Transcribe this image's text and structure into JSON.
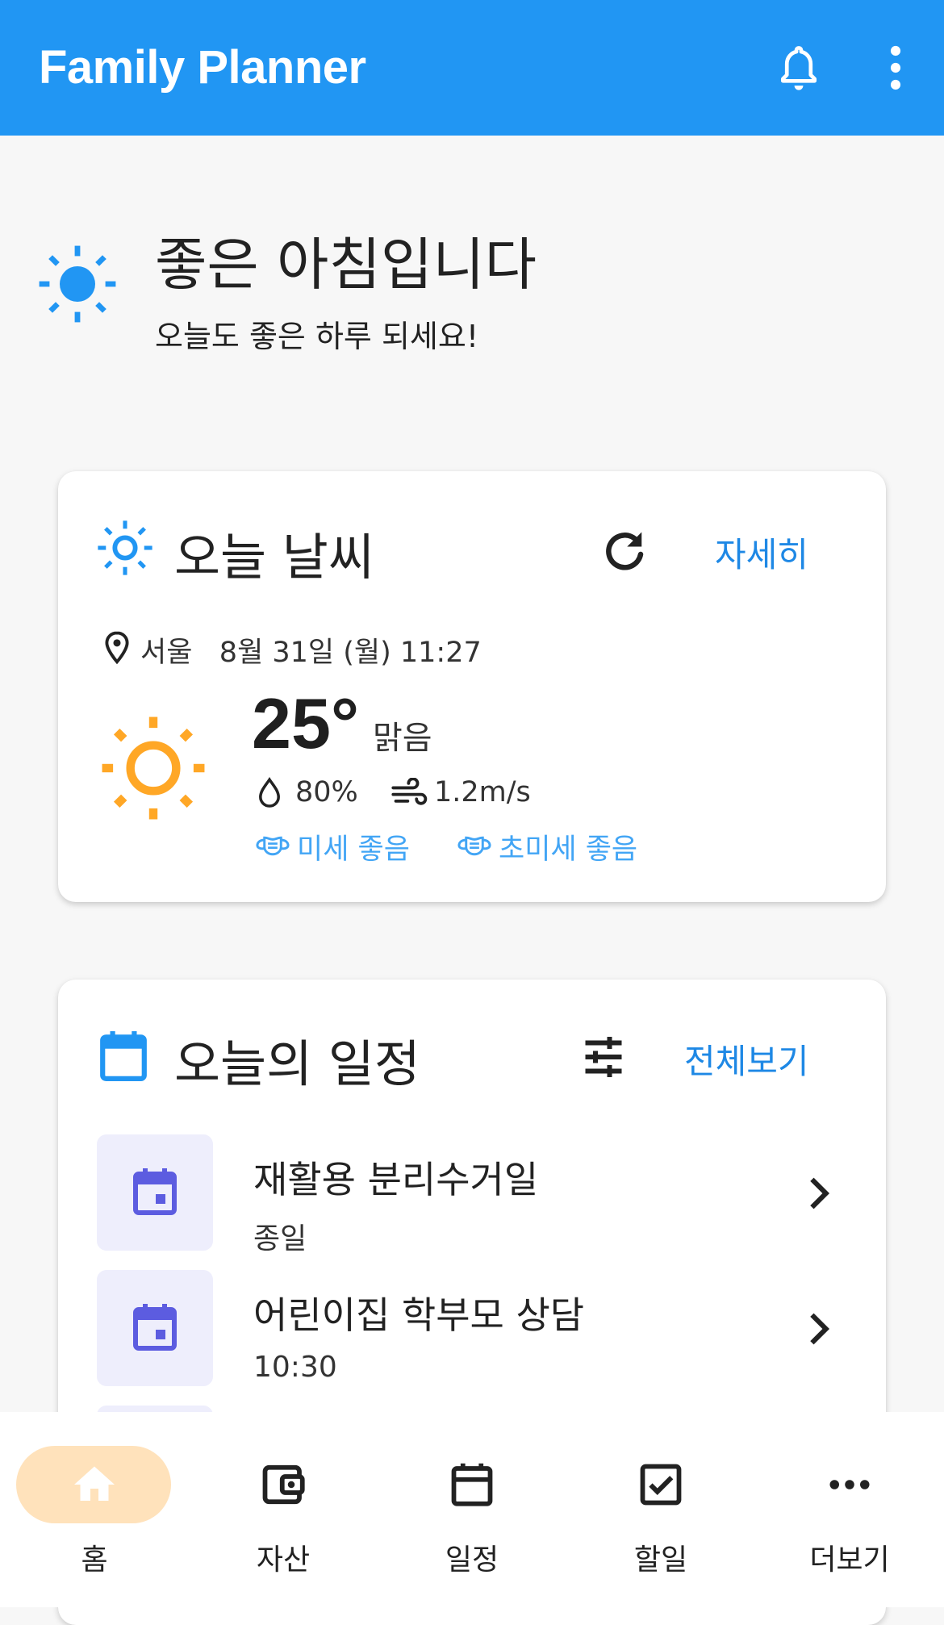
{
  "app": {
    "title": "Family Planner"
  },
  "icons": {
    "notification": "bell-icon",
    "menu": "more-vert-icon"
  },
  "greeting": {
    "title": "좋은 아침입니다",
    "subtitle": "오늘도 좋은 하루 되세요!"
  },
  "weather": {
    "title": "오늘 날씨",
    "detail_label": "자세히",
    "location": "서울",
    "datetime": "8월 31일 (월) 11:27",
    "temperature": "25°",
    "condition": "맑음",
    "humidity": "80%",
    "wind": "1.2m/s",
    "fine_dust": "미세 좋음",
    "ultrafine_dust": "초미세 좋음"
  },
  "schedule": {
    "title": "오늘의 일정",
    "view_all_label": "전체보기",
    "items": [
      {
        "title": "재활용 분리수거일",
        "time": "종일"
      },
      {
        "title": "어린이집 학부모 상담",
        "time": "10:30"
      }
    ]
  },
  "nav": {
    "items": [
      {
        "label": "홈",
        "icon": "home-icon",
        "active": true
      },
      {
        "label": "자산",
        "icon": "wallet-icon",
        "active": false
      },
      {
        "label": "일정",
        "icon": "calendar-icon",
        "active": false
      },
      {
        "label": "할일",
        "icon": "checkbox-icon",
        "active": false
      },
      {
        "label": "더보기",
        "icon": "more-horiz-icon",
        "active": false
      }
    ]
  },
  "colors": {
    "primary": "#2196f3",
    "link": "#1e88e5",
    "sun": "#ffa726",
    "air_quality": "#42a5f5",
    "schedule_icon": "#5c5ce0",
    "nav_active_pill": "#ffe2bb"
  }
}
